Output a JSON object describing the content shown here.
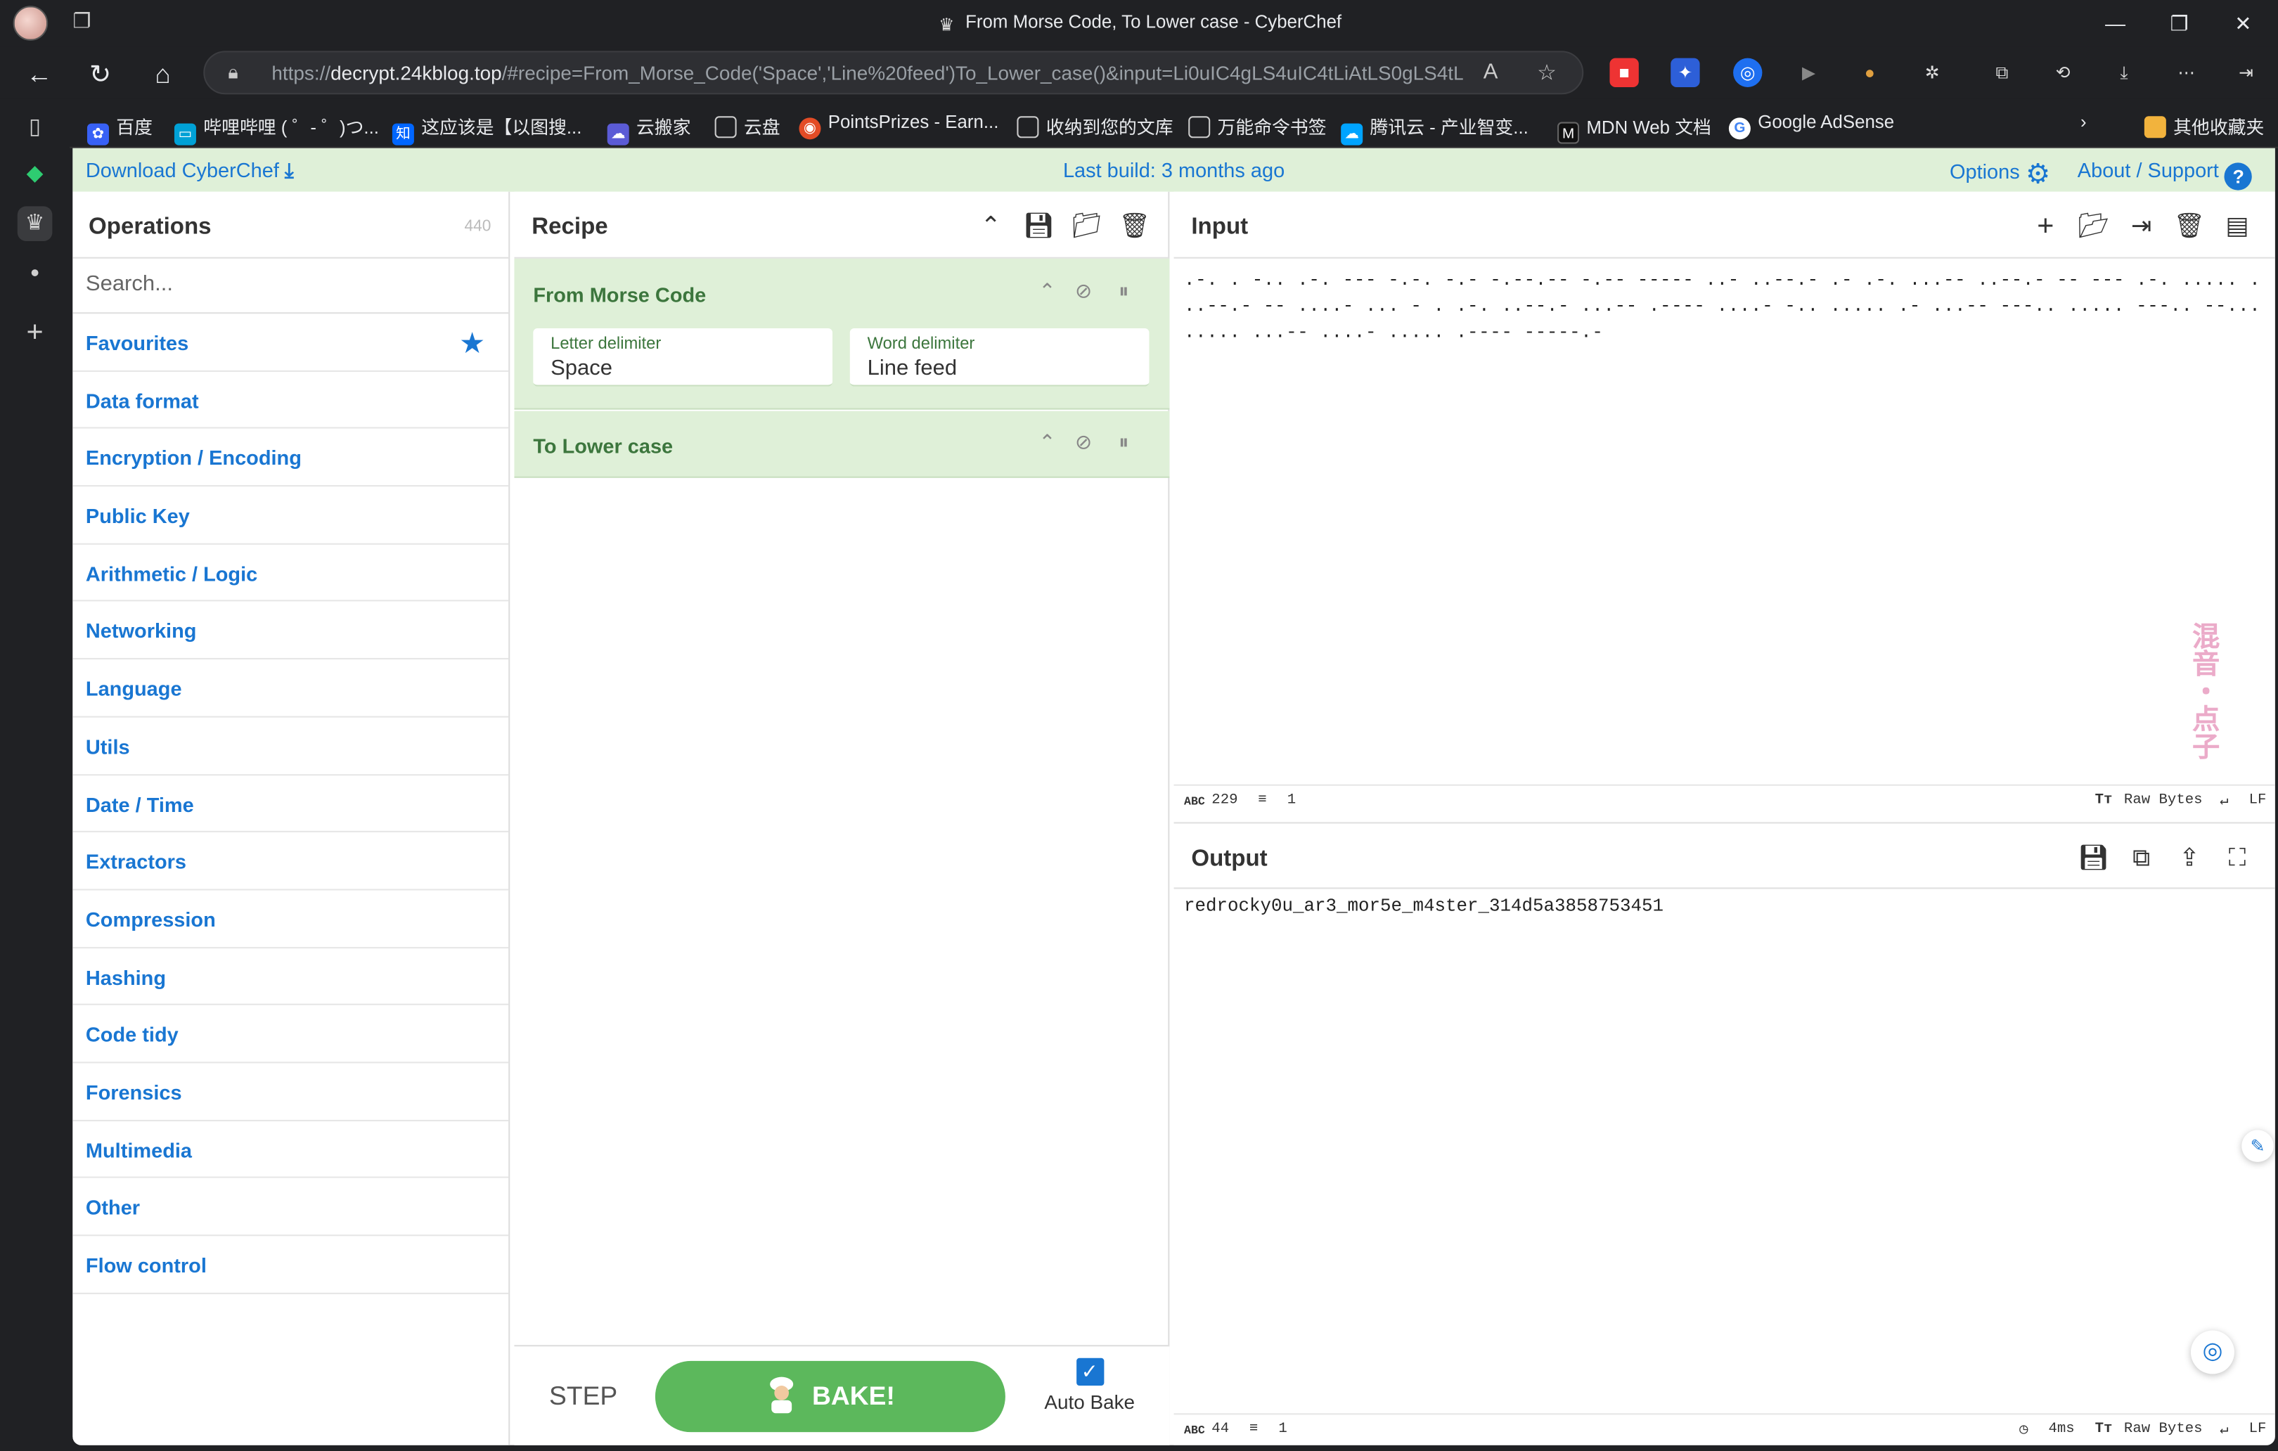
{
  "browser": {
    "window_title": "From Morse Code, To Lower case - CyberChef",
    "url_prefix": "https://",
    "url_host": "decrypt.24kblog.top",
    "url_rest": "/#recipe=From_Morse_Code('Space','Line%20feed')To_Lower_case()&input=Li0uIC4gLS4uIC4tLiAtLS0gLS4tLi...",
    "bookmarks": [
      {
        "label": "百度",
        "color": "#3861f6",
        "icon": "paw-icon"
      },
      {
        "label": "哔哩哔哩 ( ゜- ゜)つ...",
        "color": "#00a1d6",
        "icon": "tv-icon"
      },
      {
        "label": "这应该是【以图搜...",
        "color": "#0066ff",
        "icon": "zhi-icon"
      },
      {
        "label": "云搬家",
        "color": "#5b5bd6",
        "icon": "cloud-icon"
      },
      {
        "label": "云盘",
        "color": "transparent",
        "icon": "file-icon"
      },
      {
        "label": "PointsPrizes - Earn...",
        "color": "#e34c26",
        "icon": "chrome-icon"
      },
      {
        "label": "收纳到您的文库",
        "color": "transparent",
        "icon": "file-icon"
      },
      {
        "label": "万能命令书签",
        "color": "transparent",
        "icon": "file-icon"
      },
      {
        "label": "腾讯云 - 产业智变...",
        "color": "#00a4ff",
        "icon": "cloud-icon"
      },
      {
        "label": "MDN Web 文档",
        "color": "#111",
        "icon": "mdn-icon"
      },
      {
        "label": "Google AdSense",
        "color": "#fff",
        "icon": "google-icon"
      }
    ],
    "other_bookmarks": "其他收藏夹"
  },
  "banner": {
    "download": "Download CyberChef",
    "build": "Last build: 3 months ago",
    "options": "Options",
    "about": "About / Support"
  },
  "operations": {
    "title": "Operations",
    "count": "440",
    "search_placeholder": "Search...",
    "categories": [
      "Favourites",
      "Data format",
      "Encryption / Encoding",
      "Public Key",
      "Arithmetic / Logic",
      "Networking",
      "Language",
      "Utils",
      "Date / Time",
      "Extractors",
      "Compression",
      "Hashing",
      "Code tidy",
      "Forensics",
      "Multimedia",
      "Other",
      "Flow control"
    ]
  },
  "recipe": {
    "title": "Recipe",
    "ops": [
      {
        "name": "From Morse Code",
        "args": [
          {
            "label": "Letter delimiter",
            "value": "Space"
          },
          {
            "label": "Word delimiter",
            "value": "Line feed"
          }
        ]
      },
      {
        "name": "To Lower case",
        "args": []
      }
    ],
    "step_label": "STEP",
    "bake_label": "BAKE!",
    "auto_bake_label": "Auto Bake",
    "auto_bake_checked": true
  },
  "input": {
    "title": "Input",
    "text": ".-. . -.. .-. --- -.-. -.- -.--.-- -.-- ----- ..- ..--.- .- .-. ...-- ..--.- -- --- .-. ..... . ..--.- -- ....- ... - . .-. ..--.- ...-- .---- ....- -.. ..... .- ...-- ---.. ..... ---.. --... ..... ...-- ....- ..... .---- -----.-",
    "char_count": "229",
    "line_count": "1",
    "encoding": "Raw Bytes",
    "eol": "LF",
    "watermark": "混音・点子"
  },
  "output": {
    "title": "Output",
    "text": "redrocky0u_ar3_mor5e_m4ster_314d5a3858753451",
    "char_count": "44",
    "line_count": "1",
    "time": "4ms",
    "encoding": "Raw Bytes",
    "eol": "LF"
  }
}
